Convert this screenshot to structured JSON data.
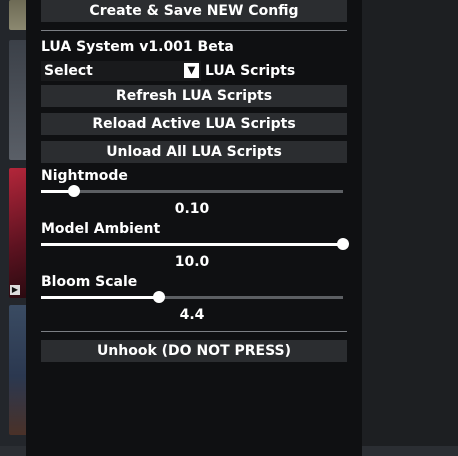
{
  "menu": {
    "create_config_label": "Create & Save NEW Config",
    "lua_system_title": "LUA System v1.001 Beta",
    "script_select": {
      "selected": "Select",
      "caption": "LUA Scripts"
    },
    "refresh_label": "Refresh LUA Scripts",
    "reload_label": "Reload Active LUA Scripts",
    "unload_label": "Unload All LUA Scripts",
    "sliders": [
      {
        "label": "Nightmode",
        "value_text": "0.10",
        "fraction": 0.11
      },
      {
        "label": "Model Ambient",
        "value_text": "10.0",
        "fraction": 1.0
      },
      {
        "label": "Bloom Scale",
        "value_text": "4.4",
        "fraction": 0.39
      }
    ],
    "unhook_label": "Unhook (DO NOT PRESS)"
  },
  "icons": {
    "dropdown": "triangle-down"
  },
  "colors": {
    "panel_bg": "#0f1012",
    "button_bg": "#2b2d30",
    "text": "#ffffff",
    "slider_track": "#5c5f63"
  }
}
